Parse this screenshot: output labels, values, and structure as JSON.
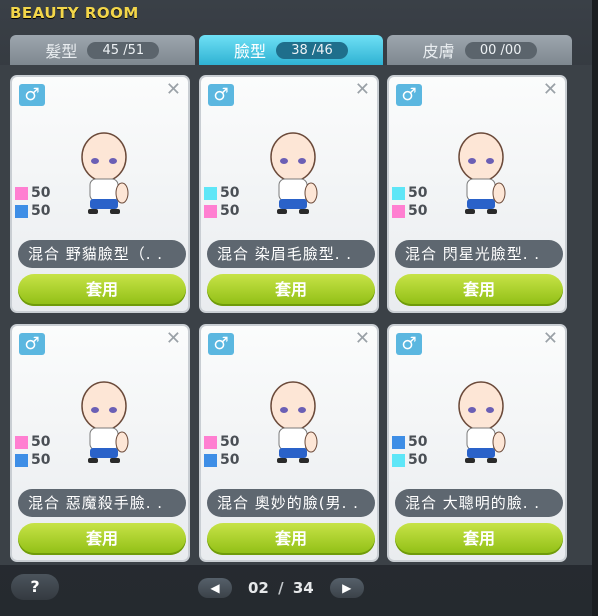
{
  "window": {
    "title": "BEAUTY ROOM"
  },
  "tabs": [
    {
      "label": "髮型",
      "count": "45 /51",
      "active": false
    },
    {
      "label": "臉型",
      "count": "38 /46",
      "active": true
    },
    {
      "label": "皮膚",
      "count": "00 /00",
      "active": false
    }
  ],
  "colors": {
    "pink": "#ff7fd1",
    "blue": "#3e8ee6",
    "cyan": "#5ee6f7",
    "apply_green": "#a3cc1f"
  },
  "cards": [
    {
      "gender_icon": "male-icon",
      "stat1_value": "50",
      "stat1_color": "pink",
      "stat2_value": "50",
      "stat2_color": "blue",
      "name": "混合 野貓臉型（. .",
      "apply_label": "套用"
    },
    {
      "gender_icon": "male-icon",
      "stat1_value": "50",
      "stat1_color": "cyan",
      "stat2_value": "50",
      "stat2_color": "pink",
      "name": "混合 染眉毛臉型. .",
      "apply_label": "套用"
    },
    {
      "gender_icon": "male-icon",
      "stat1_value": "50",
      "stat1_color": "cyan",
      "stat2_value": "50",
      "stat2_color": "pink",
      "name": "混合 閃星光臉型. .",
      "apply_label": "套用"
    },
    {
      "gender_icon": "male-icon",
      "stat1_value": "50",
      "stat1_color": "pink",
      "stat2_value": "50",
      "stat2_color": "blue",
      "name": "混合 惡魔殺手臉. .",
      "apply_label": "套用"
    },
    {
      "gender_icon": "male-icon",
      "stat1_value": "50",
      "stat1_color": "pink",
      "stat2_value": "50",
      "stat2_color": "blue",
      "name": "混合 奧妙的臉(男. .",
      "apply_label": "套用"
    },
    {
      "gender_icon": "male-icon",
      "stat1_value": "50",
      "stat1_color": "blue",
      "stat2_value": "50",
      "stat2_color": "cyan",
      "name": "混合 大聰明的臉. .",
      "apply_label": "套用"
    }
  ],
  "footer": {
    "help_label": "?",
    "current_page": "02",
    "separator": "/",
    "total_pages": "34"
  }
}
